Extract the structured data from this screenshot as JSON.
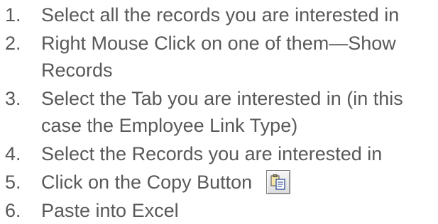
{
  "steps": [
    {
      "number": "1.",
      "text": "Select all the records you are interested in"
    },
    {
      "number": "2.",
      "text": "Right Mouse Click on one of them—Show",
      "continuation": "Records"
    },
    {
      "number": "3.",
      "text": "Select the Tab you are interested in (in this",
      "continuation": "case the Employee Link Type)"
    },
    {
      "number": "4.",
      "text": "Select the Records you are interested in"
    },
    {
      "number": "5.",
      "text": "Click on the Copy Button",
      "icon": "copy-icon"
    },
    {
      "number": "6.",
      "text": "Paste into Excel"
    }
  ],
  "colors": {
    "text": "#595959",
    "background": "#ffffff"
  }
}
